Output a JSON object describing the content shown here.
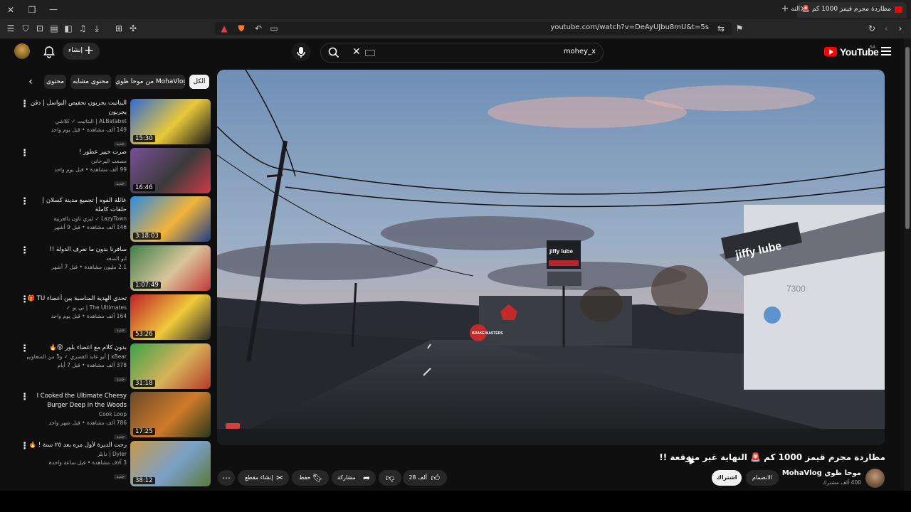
{
  "browser": {
    "tab_title": "مطاردة مجرم قيمز 1000 كم 🚨 النه",
    "url": "youtube.com/watch?v=DeAyUJbu8mU&t=5s"
  },
  "header": {
    "logo_text": "YouTube",
    "country_code": "SA",
    "search_value": "mohey_x",
    "create_label": "إنشاء"
  },
  "chips": [
    {
      "label": "الكل",
      "active": true
    },
    {
      "label": "من موحا ظوي MohaVlog",
      "active": false
    },
    {
      "label": "محتوى مشابه",
      "active": false
    },
    {
      "label": "محتوى",
      "active": false
    }
  ],
  "sidebar": {
    "videos": [
      {
        "title": "البتاتيت بجربون تحفيص البواسل | دقن يجربون",
        "channel": "ALBatabet | البتاتيت ✓ كلاشي",
        "views": "149 ألف مشاهدة • قبل يوم واحد",
        "badge": "جديد",
        "duration": "15:30",
        "thumb_colors": [
          "#2f6bd6",
          "#e9c93a",
          "#1a1a1a"
        ]
      },
      {
        "title": "صرت حيير عطور !",
        "channel": "مصعب اليرحاني",
        "views": "99 ألف مشاهدة • قبل يوم واحد",
        "badge": "جديد",
        "duration": "16:46",
        "thumb_colors": [
          "#7a4f9a",
          "#3b3b3b",
          "#d13a4a"
        ]
      },
      {
        "title": "عائلة الفوه | تجميع مدينة كسلان | حلقات كاملة",
        "channel": "LazyTown ✓ ليزي تاون بالعربية",
        "views": "146 ألف مشاهدة • قبل 9 أشهر",
        "badge": "",
        "duration": "3:18:03",
        "thumb_colors": [
          "#2c8be0",
          "#f3b43a",
          "#1d3f8a"
        ]
      },
      {
        "title": "سافرنا بدون ما نعرف الدولة !!",
        "channel": "ابو السعد",
        "views": "2.1 مليون مشاهدة • قبل 7 أشهر",
        "badge": "",
        "duration": "1:07:49",
        "thumb_colors": [
          "#3f7f4a",
          "#d8c59a",
          "#c23a3a"
        ]
      },
      {
        "title": "تحدي الهدية المناسبة بين أعضاء TU 🎁",
        "channel": "The Ultimates | تي يو ✓",
        "views": "164 ألف مشاهدة • قبل يوم واحد",
        "badge": "جديد",
        "duration": "53:26",
        "thumb_colors": [
          "#c0202a",
          "#f0c93a",
          "#2a2a2a"
        ]
      },
      {
        "title": "بدون كلام مع اعضاء بلور 😵🔥",
        "channel": "xBear | أبو عابد القصري ✓ و5 من المتعاونين الآخرين",
        "views": "378 ألف مشاهدة • قبل 7 أيام",
        "badge": "جديد",
        "duration": "31:18",
        "thumb_colors": [
          "#3aa34a",
          "#d8b25a",
          "#b33a2a"
        ]
      },
      {
        "title": "I Cooked the Ultimate Cheesy Burger Deep in the Woods",
        "channel": "Cook Loop",
        "views": "786 ألف مشاهدة • قبل شهر واحد",
        "badge": "جديد",
        "duration": "17:25",
        "thumb_colors": [
          "#6a4a2a",
          "#d07a2a",
          "#2a3a1a"
        ]
      },
      {
        "title": "رحت الديرة لأول مره بعد ٢٥ سنة ! 🔥",
        "channel": "Dyler | دايلر",
        "views": "3 آلاف مشاهدة • قبل ساعة واحدة",
        "badge": "جديد",
        "duration": "38:12",
        "thumb_colors": [
          "#c89a4a",
          "#7aa0c8",
          "#5a7a3a"
        ]
      }
    ]
  },
  "player": {
    "sign_text_1": "jiffy lube",
    "sign_text_2": "jiffy lube",
    "sign_text_3": "BRAKE MASTERS",
    "building_number": "7300"
  },
  "video": {
    "title": "مطاردة مجرم قيمز 1000 كم 🚨 النهاية غير متوقعة !!",
    "channel_name": "موحا ظوي MohaVlog",
    "subscribers": "400 ألف مشترك",
    "join_label": "الانضمام",
    "subscribe_label": "اشتراك",
    "like_count": "28 ألف",
    "share_label": "مشاركة",
    "save_label": "حفظ",
    "clip_label": "إنشاء مقطع"
  }
}
